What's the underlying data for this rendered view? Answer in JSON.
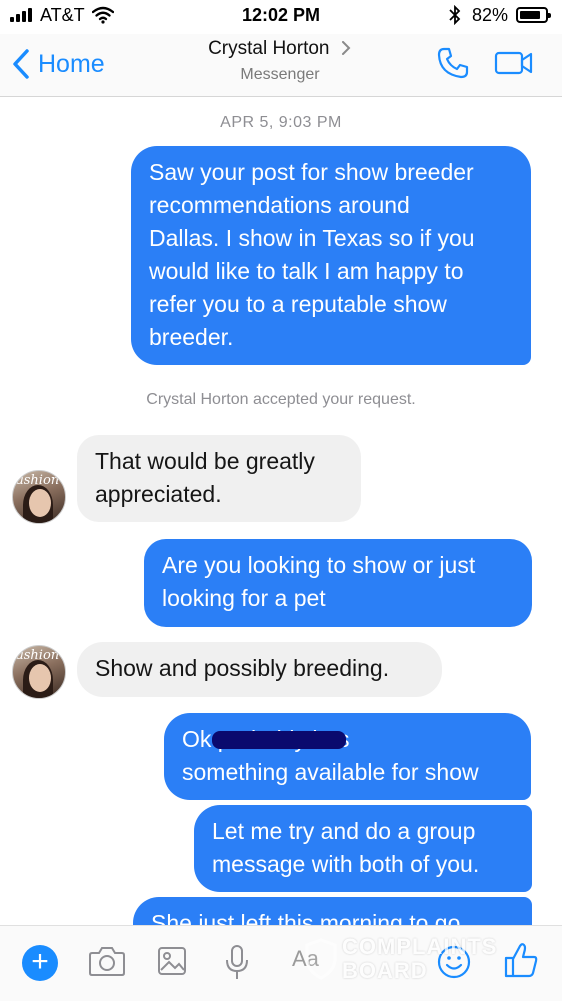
{
  "status_bar": {
    "carrier": "AT&T",
    "time": "12:02 PM",
    "battery_percent": "82%",
    "battery_level": 0.82,
    "icons": [
      "signal-bars-icon",
      "wifi-icon",
      "bluetooth-icon",
      "battery-icon"
    ]
  },
  "header": {
    "back_label": "Home",
    "contact_name": "Crystal Horton",
    "subtitle": "Messenger",
    "icons": [
      "back-chevron-icon",
      "phone-icon",
      "video-camera-icon"
    ]
  },
  "conversation": {
    "timestamp": "APR 5, 9:03 PM",
    "system_note": "Crystal Horton accepted your request.",
    "messages": [
      {
        "sender": "me",
        "text": "Saw your post for show breeder\nrecommendations around\nDallas.  I show in Texas so if you\nwould like to talk I am happy to\nrefer you to a reputable show\nbreeder."
      },
      {
        "sender": "Crystal Horton",
        "text": "That would be greatly\nappreciated."
      },
      {
        "sender": "me",
        "text": "Are you looking to show or just\nlooking for a pet"
      },
      {
        "sender": "Crystal Horton",
        "text": "Show and possibly breeding."
      },
      {
        "sender": "me",
        "text": "Ok                     probably has\nsomething available for show"
      },
      {
        "sender": "me",
        "text": "Let me try and do a group\nmessage with both of you."
      },
      {
        "sender": "me",
        "text": "She just left this morning to go"
      }
    ],
    "avatar_text": "ashion"
  },
  "composer": {
    "input_placeholder": "Aa",
    "icons": [
      "plus-icon",
      "camera-icon",
      "photo-icon",
      "microphone-icon",
      "emoji-icon",
      "thumbs-up-icon"
    ]
  },
  "watermark": {
    "line1": "COMPLAINTS",
    "line2": "BOARD"
  },
  "colors": {
    "accent": "#1a8cff",
    "outgoing_bubble": "#2b7ff6",
    "incoming_bubble": "#f0f0f0",
    "meta_text": "#8e8e93"
  }
}
